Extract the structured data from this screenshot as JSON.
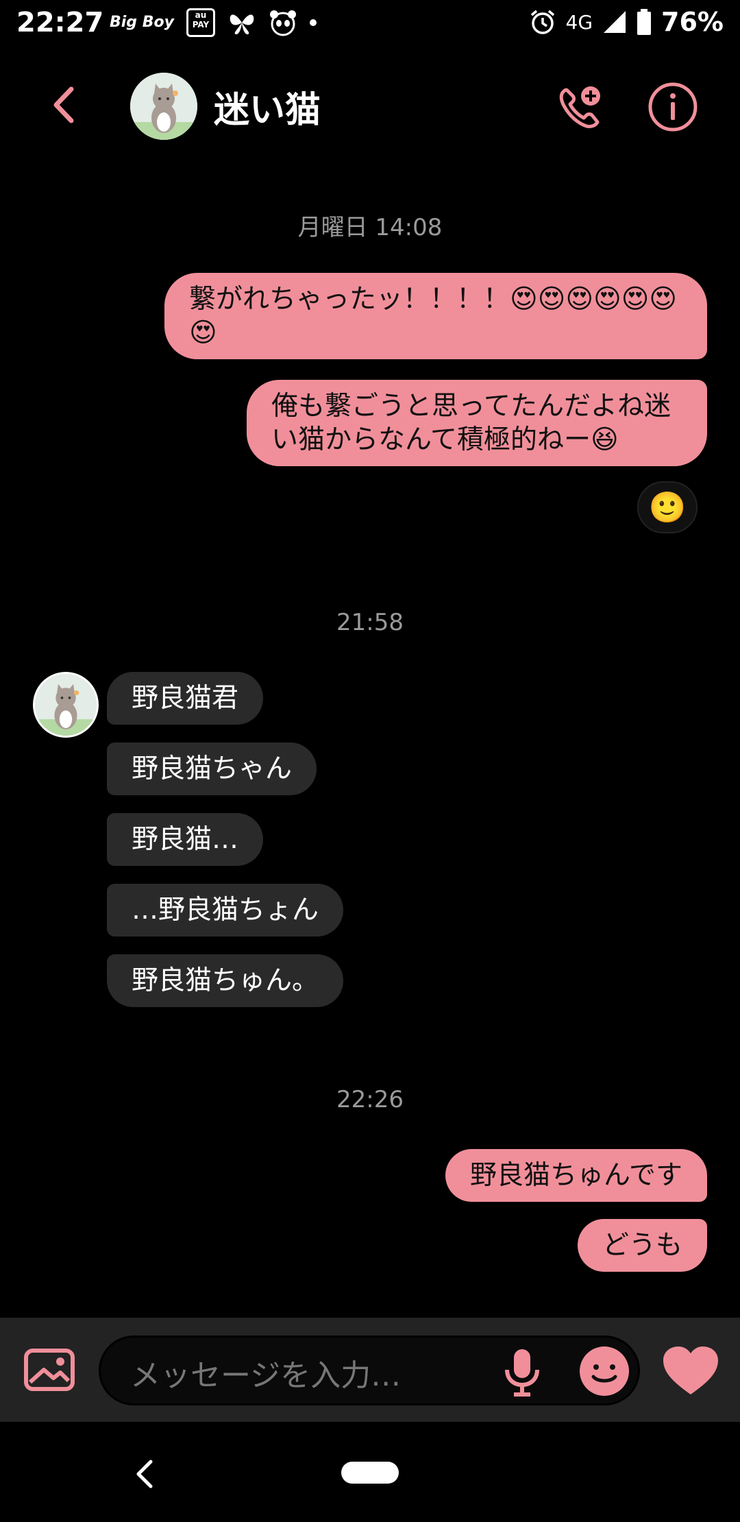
{
  "status_bar": {
    "time": "22:27",
    "app_icons": [
      "Big Boy",
      "au PAY",
      "butterfly-icon",
      "panda-icon"
    ],
    "bigboy_text": "Big Boy",
    "aupay_text": "au PAY",
    "network": "4G",
    "battery": "76%"
  },
  "header": {
    "contact_name": "迷い猫"
  },
  "messages": {
    "stamp1": "月曜日 14:08",
    "out1": "繋がれちゃったッ！！！！😍😍😍😍😍😍😍",
    "out2": "俺も繋ごうと思ってたんだよね迷い猫からなんて積極的ねー😆",
    "reaction": "🙂",
    "stamp2": "21:58",
    "in1": "野良猫君",
    "in2": "野良猫ちゃん",
    "in3": "野良猫…",
    "in4": "…野良猫ちょん",
    "in5": "野良猫ちゅん。",
    "stamp3": "22:26",
    "out3": "野良猫ちゅんです",
    "out4": "どうも"
  },
  "input": {
    "placeholder": "メッセージを入力…"
  },
  "colors": {
    "accent": "#f08f9a",
    "incoming_bubble": "#2a2a2a",
    "background": "#000000"
  }
}
